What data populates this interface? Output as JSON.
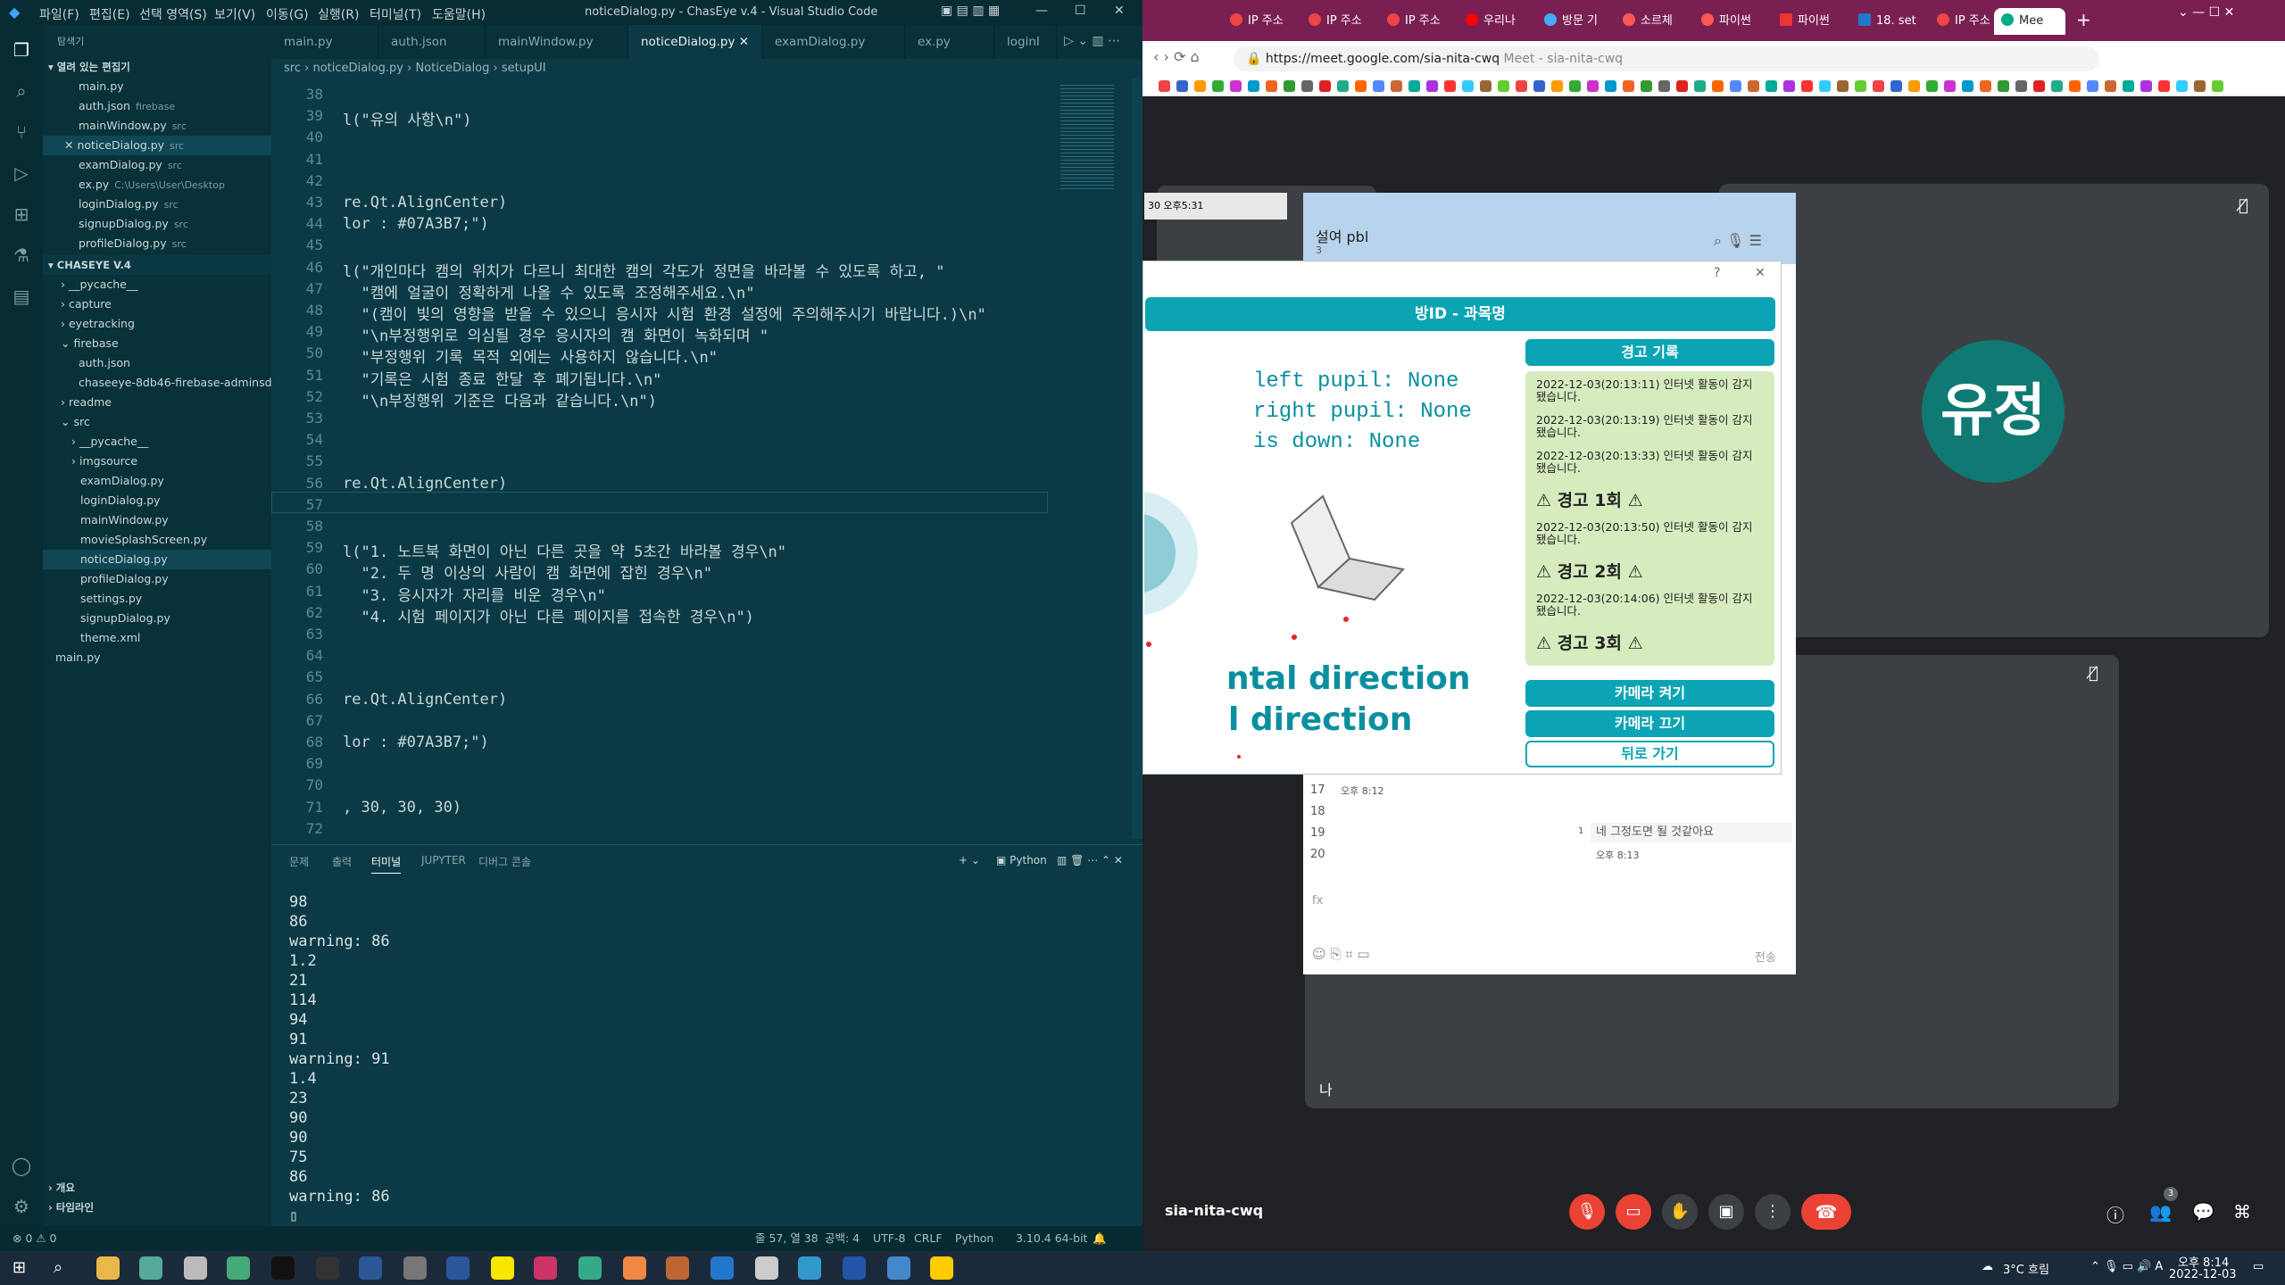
{
  "vscode": {
    "window_title": "noticeDialog.py - ChasEye v.4 - Visual Studio Code",
    "menu": [
      "파일(F)",
      "편집(E)",
      "선택 영역(S)",
      "보기(V)",
      "이동(G)",
      "실행(R)",
      "터미널(T)",
      "도움말(H)"
    ],
    "explorer_title": "탐색기",
    "open_editors_title": "열려 있는 편집기",
    "open_editors": [
      {
        "name": "main.py",
        "desc": ""
      },
      {
        "name": "auth.json",
        "desc": "firebase"
      },
      {
        "name": "mainWindow.py",
        "desc": "src"
      },
      {
        "name": "noticeDialog.py",
        "desc": "src"
      },
      {
        "name": "examDialog.py",
        "desc": "src"
      },
      {
        "name": "ex.py",
        "desc": "C:\\Users\\User\\Desktop"
      },
      {
        "name": "loginDialog.py",
        "desc": "src"
      },
      {
        "name": "signupDialog.py",
        "desc": "src"
      },
      {
        "name": "profileDialog.py",
        "desc": "src"
      }
    ],
    "project_title": "CHASEYE V.4",
    "tree": [
      "__pycache__",
      "capture",
      "eyetracking",
      "firebase",
      "auth.json",
      "chaseeye-8db46-firebase-adminsd...",
      "readme",
      "src",
      "__pycache__",
      "imgsource",
      "examDialog.py",
      "loginDialog.py",
      "mainWindow.py",
      "movieSplashScreen.py",
      "noticeDialog.py",
      "profileDialog.py",
      "settings.py",
      "signupDialog.py",
      "theme.xml",
      "main.py"
    ],
    "outline": [
      "개요",
      "타임라인"
    ],
    "tabs": [
      "main.py",
      "auth.json",
      "mainWindow.py",
      "noticeDialog.py",
      "examDialog.py",
      "ex.py",
      "loginI"
    ],
    "breadcrumb": [
      "src",
      "noticeDialog.py",
      "NoticeDialog",
      "setupUI"
    ],
    "code_lines": [
      {
        "n": "38",
        "t": ""
      },
      {
        "n": "39",
        "t": "l(\"유의 사항\\n\")"
      },
      {
        "n": "40",
        "t": ""
      },
      {
        "n": "41",
        "t": ""
      },
      {
        "n": "42",
        "t": ""
      },
      {
        "n": "43",
        "t": "re.Qt.AlignCenter)"
      },
      {
        "n": "44",
        "t": "lor : #07A3B7;\")"
      },
      {
        "n": "45",
        "t": ""
      },
      {
        "n": "46",
        "t": "l(\"개인마다 캠의 위치가 다르니 최대한 캠의 각도가 정면을 바라볼 수 있도록 하고, \""
      },
      {
        "n": "47",
        "t": "  \"캠에 얼굴이 정확하게 나올 수 있도록 조정해주세요.\\n\""
      },
      {
        "n": "48",
        "t": "  \"(캠이 빛의 영향을 받을 수 있으니 응시자 시험 환경 설정에 주의해주시기 바랍니다.)\\n\""
      },
      {
        "n": "49",
        "t": "  \"\\n부정행위로 의심될 경우 응시자의 캠 화면이 녹화되며 \""
      },
      {
        "n": "50",
        "t": "  \"부정행위 기록 목적 외에는 사용하지 않습니다.\\n\""
      },
      {
        "n": "51",
        "t": "  \"기록은 시험 종료 한달 후 폐기됩니다.\\n\""
      },
      {
        "n": "52",
        "t": "  \"\\n부정행위 기준은 다음과 같습니다.\\n\")"
      },
      {
        "n": "53",
        "t": ""
      },
      {
        "n": "54",
        "t": ""
      },
      {
        "n": "55",
        "t": ""
      },
      {
        "n": "56",
        "t": "re.Qt.AlignCenter)"
      },
      {
        "n": "57",
        "t": ""
      },
      {
        "n": "58",
        "t": ""
      },
      {
        "n": "59",
        "t": "l(\"1. 노트북 화면이 아닌 다른 곳을 약 5초간 바라볼 경우\\n\""
      },
      {
        "n": "60",
        "t": "  \"2. 두 명 이상의 사람이 캠 화면에 잡힌 경우\\n\""
      },
      {
        "n": "61",
        "t": "  \"3. 응시자가 자리를 비운 경우\\n\""
      },
      {
        "n": "62",
        "t": "  \"4. 시험 페이지가 아닌 다른 페이지를 접속한 경우\\n\")"
      },
      {
        "n": "63",
        "t": ""
      },
      {
        "n": "64",
        "t": ""
      },
      {
        "n": "65",
        "t": ""
      },
      {
        "n": "66",
        "t": "re.Qt.AlignCenter)"
      },
      {
        "n": "67",
        "t": ""
      },
      {
        "n": "68",
        "t": "lor : #07A3B7;\")"
      },
      {
        "n": "69",
        "t": ""
      },
      {
        "n": "70",
        "t": ""
      },
      {
        "n": "71",
        "t": ", 30, 30, 30)"
      },
      {
        "n": "72",
        "t": ""
      }
    ],
    "panel_tabs": [
      "문제",
      "출력",
      "터미널",
      "JUPYTER",
      "디버그 콘솔"
    ],
    "panel_python": "Python",
    "terminal": [
      "98",
      "86",
      "warning: 86",
      "1.2",
      "21",
      "114",
      "94",
      "91",
      "warning: 91",
      "1.4",
      "23",
      "90",
      "90",
      "75",
      "86",
      "warning: 86"
    ],
    "status_left": "⊗ 0 ⚠ 0",
    "status_right": [
      "줄 57, 열 38",
      "공백: 4",
      "UTF-8",
      "CRLF",
      "Python",
      "3.10.4 64-bit"
    ]
  },
  "chrome": {
    "tabs": [
      "IP 주소",
      "IP 주소",
      "IP 주소",
      "우리나",
      "방문 기",
      "소르체",
      "파이썬",
      "파이썬",
      "18. set",
      "IP 주소",
      "Mee"
    ],
    "url": "https://meet.google.com/sia-nita-cwq",
    "url_suffix": "Meet - sia-nita-cwq",
    "meeting_code": "sia-nita-cwq",
    "avatar_name": "유정",
    "self_label": "나",
    "participants_count": "3"
  },
  "chat_window": {
    "title": "설여 pbl",
    "sub": "3",
    "timestamp": "30 오후5:31",
    "rows": [
      "17",
      "18",
      "19",
      "20"
    ],
    "row17_time": "오후 8:12",
    "message": "네 그정도면 될 것같아요",
    "message_time": "오후 8:13",
    "unread": "1",
    "fx": "fx",
    "send": "전송"
  },
  "dialog": {
    "header": "방ID - 과목명",
    "pupil_lines": [
      "left pupil:  None",
      "right pupil: None",
      "is down: None"
    ],
    "direction_lines": [
      "ntal direction",
      "l direction"
    ],
    "log_title": "경고 기록",
    "log": [
      {
        "kind": "msg",
        "text": "2022-12-03(20:13:11) 인터넷 활동이 감지됐습니다."
      },
      {
        "kind": "msg",
        "text": "2022-12-03(20:13:19) 인터넷 활동이 감지됐습니다."
      },
      {
        "kind": "msg",
        "text": "2022-12-03(20:13:33) 인터넷 활동이 감지됐습니다."
      },
      {
        "kind": "warn",
        "text": "경고 1회"
      },
      {
        "kind": "msg",
        "text": "2022-12-03(20:13:50) 인터넷 활동이 감지됐습니다."
      },
      {
        "kind": "warn",
        "text": "경고 2회"
      },
      {
        "kind": "msg",
        "text": "2022-12-03(20:14:06) 인터넷 활동이 감지됐습니다."
      },
      {
        "kind": "warn",
        "text": "경고 3회"
      }
    ],
    "btn_camera_on": "카메라 켜기",
    "btn_camera_off": "카메라 끄기",
    "btn_back": "뒤로 가기"
  },
  "taskbar": {
    "weather": "3°C 흐림",
    "time": "오후 8:14",
    "date": "2022-12-03"
  }
}
